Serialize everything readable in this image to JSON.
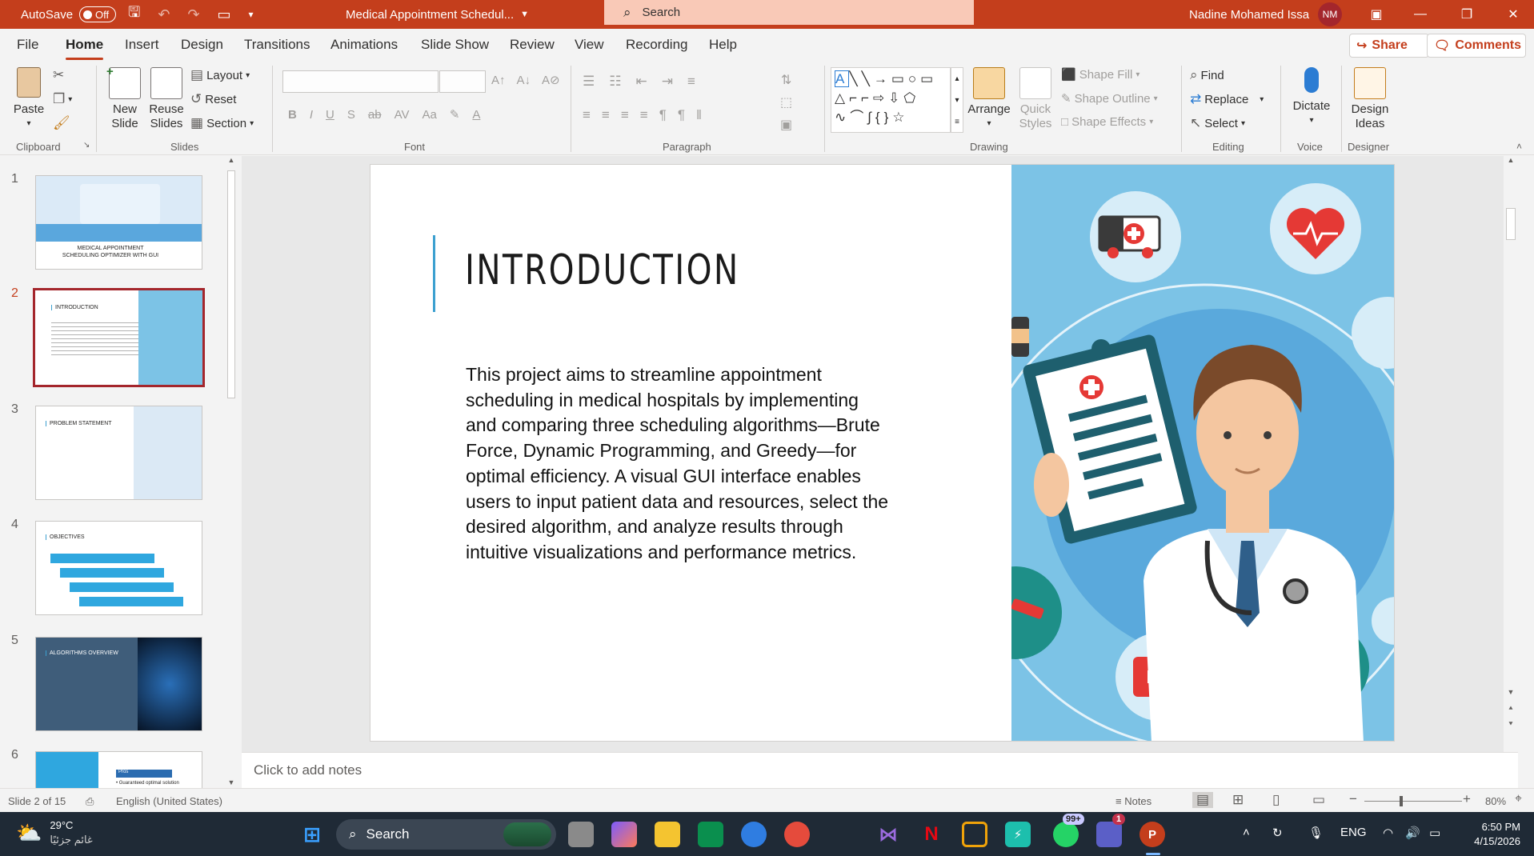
{
  "titlebar": {
    "autosave_label": "AutoSave",
    "autosave_state": "Off",
    "doc_title": "Medical Appointment Schedul...",
    "search_placeholder": "Search",
    "user_name": "Nadine Mohamed Issa",
    "user_initials": "NM"
  },
  "menu": {
    "tabs": [
      "File",
      "Home",
      "Insert",
      "Design",
      "Transitions",
      "Animations",
      "Slide Show",
      "Review",
      "View",
      "Recording",
      "Help"
    ],
    "active": "Home",
    "share_label": "Share",
    "comments_label": "Comments"
  },
  "ribbon": {
    "clipboard": {
      "paste": "Paste",
      "group": "Clipboard"
    },
    "slides": {
      "new_slide": "New Slide",
      "reuse_slides": "Reuse Slides",
      "layout": "Layout",
      "reset": "Reset",
      "section": "Section",
      "group": "Slides"
    },
    "font": {
      "group": "Font"
    },
    "paragraph": {
      "group": "Paragraph"
    },
    "drawing": {
      "arrange": "Arrange",
      "quick_styles": "Quick Styles",
      "shape_fill": "Shape Fill",
      "shape_outline": "Shape Outline",
      "shape_effects": "Shape Effects",
      "group": "Drawing"
    },
    "editing": {
      "find": "Find",
      "replace": "Replace",
      "select": "Select",
      "group": "Editing"
    },
    "voice": {
      "dictate": "Dictate",
      "group": "Voice"
    },
    "designer": {
      "design_ideas": "Design Ideas",
      "group": "Designer"
    }
  },
  "thumbnails": [
    {
      "num": "1",
      "title": "MEDICAL APPOINTMENT SCHEDULING OPTIMIZER WITH GUI"
    },
    {
      "num": "2",
      "title": "INTRODUCTION"
    },
    {
      "num": "3",
      "title": "PROBLEM STATEMENT"
    },
    {
      "num": "4",
      "title": "OBJECTIVES"
    },
    {
      "num": "5",
      "title": "ALGORITHMS OVERVIEW"
    },
    {
      "num": "6",
      "title": "Pros"
    }
  ],
  "thumb6_text": "• Guaranteed optimal solution",
  "slide": {
    "title": "INTRODUCTION",
    "body": "This project aims to streamline appointment scheduling in medical hospitals by implementing and comparing three scheduling algorithms—Brute Force, Dynamic Programming, and Greedy—for optimal efficiency. A visual GUI interface enables users to input patient data and resources, select the desired algorithm, and analyze results through intuitive visualizations and performance metrics."
  },
  "notes_placeholder": "Click to add notes",
  "statusbar": {
    "slide_indicator": "Slide 2 of 15",
    "language": "English (United States)",
    "notes_label": "Notes",
    "zoom": "80%"
  },
  "taskbar": {
    "weather_temp": "29°C",
    "weather_desc": "غائم جزئيًا",
    "search_label": "Search",
    "whatsapp_badge": "99+",
    "teams_badge": "1",
    "lang": "ENG",
    "time": "6:50 PM",
    "date": "4/15/2026"
  },
  "colors": {
    "accent": "#c43e1c",
    "slide_accent": "#3ca0d0",
    "illustration_bg": "#7cc3e6"
  }
}
